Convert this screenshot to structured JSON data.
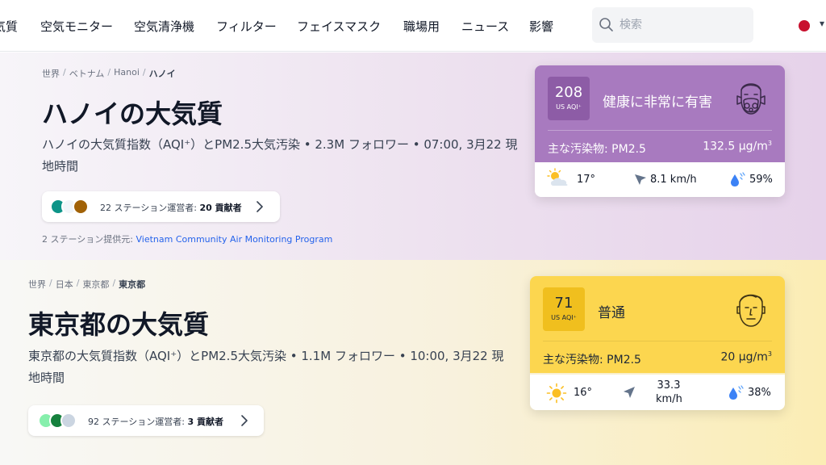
{
  "nav": {
    "items": [
      "気質",
      "空気モニター",
      "空気清浄機",
      "フィルター",
      "フェイスマスク",
      "職場用",
      "ニュース",
      "影響"
    ],
    "search_placeholder": "検索"
  },
  "colors": {
    "hanoi_card": "#a87abf",
    "hanoi_badge": "#8d5ca6",
    "tokyo_card": "#fcd64f",
    "tokyo_badge": "#f0bf1e",
    "link": "#2563eb"
  },
  "hanoi": {
    "breadcrumb": [
      "世界",
      "ベトナム",
      "Hanoi",
      "ハノイ"
    ],
    "title": "ハノイの大気質",
    "subtitle": "ハノイの大気質指数（AQI⁺）とPM2.5大気汚染 • 2.3M フォロワー • 07:00, 3月22 現地時間",
    "contributors": {
      "stations_text": "22 ステーション運営者:",
      "count_text": "20 貢献者"
    },
    "provider": {
      "label": "2 ステーション提供元:",
      "name": "Vietnam Community Air Monitoring Program"
    },
    "aqi": {
      "value": "208",
      "unit": "US AQI⁺",
      "level": "健康に非常に有害",
      "pollutant_label": "主な汚染物: PM2.5",
      "pollutant_value": "132.5",
      "pollutant_unit": "µg/m",
      "pollutant_exp": "3",
      "icon": "face-with-gas-mask-icon",
      "weather": {
        "icon": "partly-cloudy-icon",
        "temp": "17°",
        "wind": "8.1 km/h",
        "humidity": "59%"
      }
    }
  },
  "tokyo": {
    "breadcrumb": [
      "世界",
      "日本",
      "東京都",
      "東京都"
    ],
    "title": "東京都の大気質",
    "subtitle": "東京都の大気質指数（AQI⁺）とPM2.5大気汚染 • 1.1M フォロワー • 10:00, 3月22 現地時間",
    "contributors": {
      "stations_text": "92 ステーション運営者:",
      "count_text": "3 貢献者"
    },
    "aqi": {
      "value": "71",
      "unit": "US AQI⁺",
      "level": "普通",
      "pollutant_label": "主な汚染物: PM2.5",
      "pollutant_value": "20",
      "pollutant_unit": "µg/m",
      "pollutant_exp": "3",
      "icon": "neutral-face-icon",
      "weather": {
        "icon": "sun-icon",
        "temp": "16°",
        "wind_value": "33.3",
        "wind_unit": "km/h",
        "humidity": "38%"
      }
    }
  }
}
